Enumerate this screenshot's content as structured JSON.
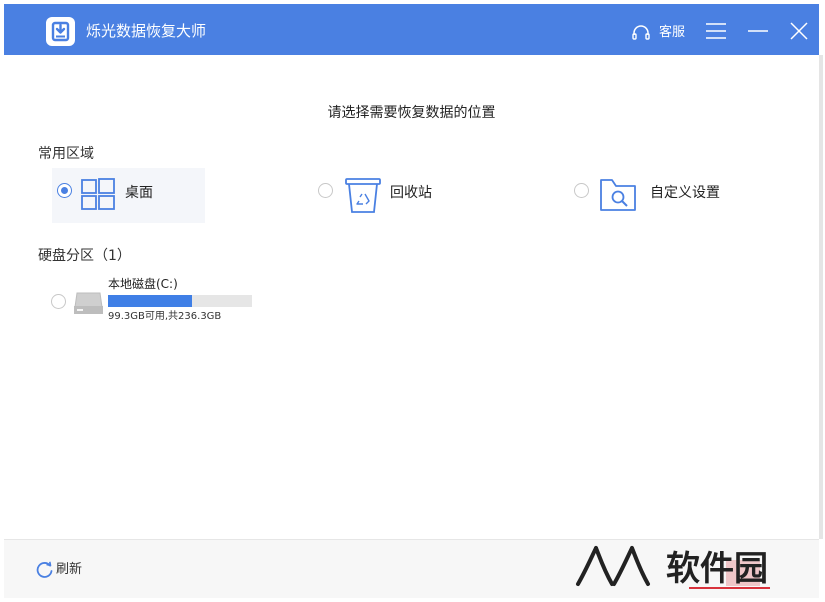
{
  "titlebar": {
    "app_title": "烁光数据恢复大师",
    "service_label": "客服",
    "logo_icon": "download-box-icon",
    "accent_color": "#4a80e2"
  },
  "main": {
    "prompt": "请选择需要恢复数据的位置",
    "common_section": {
      "title": "常用区域",
      "options": [
        {
          "label": "桌面",
          "icon": "windows-icon",
          "selected": true
        },
        {
          "label": "回收站",
          "icon": "recycle-bin-icon",
          "selected": false
        },
        {
          "label": "自定义设置",
          "icon": "folder-search-icon",
          "selected": false
        }
      ]
    },
    "disk_section": {
      "title": "硬盘分区（1）",
      "disks": [
        {
          "name": "本地磁盘(C:)",
          "info": "99.3GB可用,共236.3GB",
          "used_fraction": 0.58,
          "selected": false
        }
      ]
    }
  },
  "footer": {
    "refresh_label": "刷新"
  },
  "watermark": {
    "text": "软件园"
  }
}
